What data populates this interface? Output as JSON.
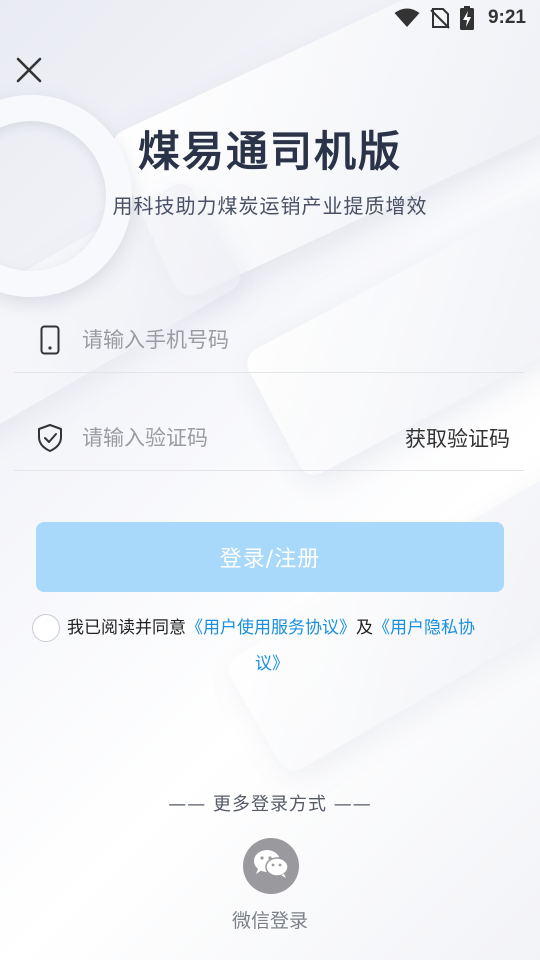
{
  "status_bar": {
    "time": "9:21",
    "icons": [
      "wifi-icon",
      "no-sim-icon",
      "battery-charging-icon"
    ]
  },
  "header": {
    "close_icon": "close-icon",
    "title": "煤易通司机版",
    "subtitle": "用科技助力煤炭运销产业提质增效"
  },
  "form": {
    "phone": {
      "icon": "phone-icon",
      "placeholder": "请输入手机号码",
      "value": ""
    },
    "code": {
      "icon": "shield-check-icon",
      "placeholder": "请输入验证码",
      "value": "",
      "get_code_label": "获取验证码"
    },
    "submit_label": "登录/注册"
  },
  "agreement": {
    "prefix": "我已阅读并同意",
    "terms_link_part1": "《用户使用服务协议》",
    "conjunction": "及",
    "privacy_link_part1": "《用户隐私协",
    "privacy_link_part2": "议》",
    "checked": false
  },
  "alt_login": {
    "divider_label": "—— 更多登录方式 ——",
    "wechat_icon": "wechat-icon",
    "wechat_label": "微信登录"
  },
  "colors": {
    "title": "#2b3349",
    "primary_button": "#a8d8fa",
    "link": "#1a8fe0",
    "wechat_circle": "#9a9a9e"
  }
}
